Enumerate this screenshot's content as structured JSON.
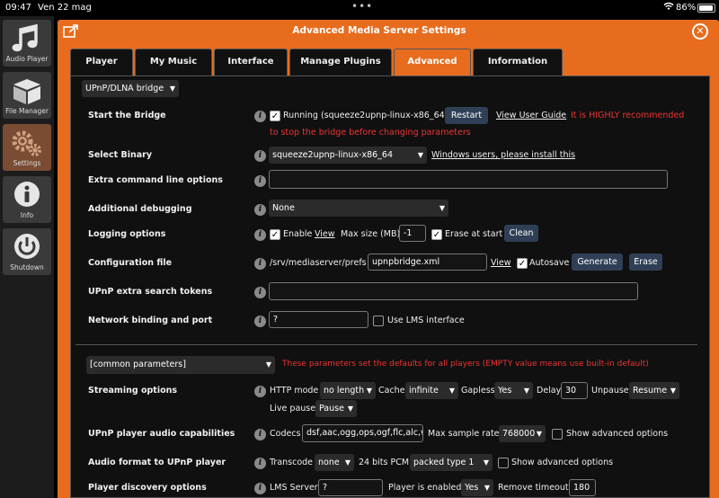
{
  "status_bar": {
    "time": "09:47",
    "date": "Ven 22 mag",
    "battery": "86%"
  },
  "sidebar": {
    "items": [
      {
        "label": "Audio Player",
        "icon": "music-note-icon"
      },
      {
        "label": "File Manager",
        "icon": "box-icon"
      },
      {
        "label": "Settings",
        "icon": "gears-icon"
      },
      {
        "label": "Info",
        "icon": "info-icon"
      },
      {
        "label": "Shutdown",
        "icon": "power-icon"
      }
    ]
  },
  "dialog": {
    "title": "Advanced Media Server Settings",
    "close": "✕"
  },
  "tabs": [
    "Player",
    "My Music",
    "Interface",
    "Manage Plugins",
    "Advanced",
    "Information"
  ],
  "section_select": "UPnP/DLNA bridge",
  "rows": {
    "start_bridge": {
      "label": "Start the Bridge",
      "status": "Running (squeeze2upnp-linux-x86_64)",
      "restart": "Restart",
      "guide": "View User Guide",
      "warning1": "It is HIGHLY recommended",
      "warning2": "to stop the bridge before changing parameters"
    },
    "select_binary": {
      "label": "Select Binary",
      "value": "squeeze2upnp-linux-x86_64",
      "windows_link": "Windows users, please install this"
    },
    "extra_cmd": {
      "label": "Extra command line options"
    },
    "debugging": {
      "label": "Additional debugging",
      "value": "None"
    },
    "logging": {
      "label": "Logging options",
      "enable": "Enable",
      "view": "View",
      "max_size": "Max size (MB)",
      "max_size_value": "-1",
      "erase": "Erase at start",
      "clean": "Clean"
    },
    "config": {
      "label": "Configuration file",
      "path": "/srv/mediaserver/prefs",
      "file": "upnpbridge.xml",
      "view": "View",
      "autosave": "Autosave",
      "generate": "Generate",
      "erase": "Erase"
    },
    "search_tokens": {
      "label": "UPnP extra search tokens"
    },
    "network": {
      "label": "Network binding and port",
      "value": "?",
      "lms_iface": "Use LMS interface"
    }
  },
  "common": {
    "select": "[common parameters]",
    "note": "These parameters set the defaults for all players (EMPTY value means use built-in default)",
    "streaming": {
      "label": "Streaming options",
      "http_mode": "HTTP mode",
      "http_mode_value": "no length",
      "cache": "Cache",
      "cache_value": "infinite",
      "gapless": "Gapless",
      "gapless_value": "Yes",
      "delay": "Delay",
      "delay_value": "30",
      "unpause": "Unpause",
      "unpause_value": "Resume",
      "live_pause": "Live pause",
      "live_pause_value": "Pause"
    },
    "audio_caps": {
      "label": "UPnP player audio capabilities",
      "codecs": "Codecs",
      "codecs_value": "dsf,aac,ogg,ops,ogf,flc,alc,w",
      "max_rate": "Max sample rate",
      "max_rate_value": "768000",
      "show_adv": "Show advanced options"
    },
    "audio_format": {
      "label": "Audio format to UPnP player",
      "transcode": "Transcode",
      "transcode_value": "none",
      "pcm24": "24 bits PCM",
      "pcm24_value": "packed type 1",
      "show_adv": "Show advanced options"
    },
    "discovery": {
      "label": "Player discovery options",
      "lms_server": "LMS Server",
      "lms_server_value": "?",
      "enabled": "Player is enabled",
      "enabled_value": "Yes",
      "remove_timeout": "Remove timeout",
      "remove_timeout_value": "180"
    }
  },
  "colors": {
    "accent": "#e86c1e",
    "warning": "#e33333",
    "button": "#2f3f55"
  }
}
